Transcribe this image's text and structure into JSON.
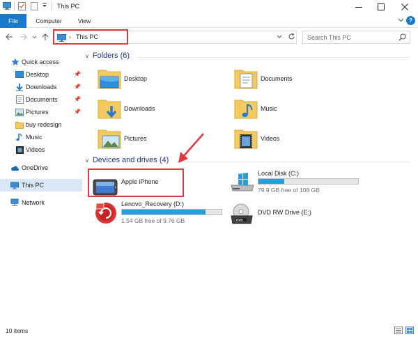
{
  "window": {
    "title": "This PC",
    "controls": {
      "minimize": "minimize",
      "maximize": "maximize",
      "close": "close"
    }
  },
  "ribbon": {
    "tabs": [
      {
        "label": "File",
        "active": true
      },
      {
        "label": "Computer",
        "active": false
      },
      {
        "label": "View",
        "active": false
      }
    ],
    "help": "?"
  },
  "navigation": {
    "address_segment": "This PC",
    "search_placeholder": "Search This PC"
  },
  "sidebar": {
    "quick_access": "Quick access",
    "items": [
      {
        "label": "Desktop",
        "icon": "desktop-folder-icon",
        "pinned": true
      },
      {
        "label": "Downloads",
        "icon": "downloads-icon",
        "pinned": true
      },
      {
        "label": "Documents",
        "icon": "documents-icon",
        "pinned": true
      },
      {
        "label": "Pictures",
        "icon": "pictures-icon",
        "pinned": true
      },
      {
        "label": "buy redesign",
        "icon": "folder-icon",
        "pinned": false
      },
      {
        "label": "Music",
        "icon": "music-icon",
        "pinned": false
      },
      {
        "label": "Videos",
        "icon": "videos-icon",
        "pinned": false
      }
    ],
    "onedrive": "OneDrive",
    "this_pc": "This PC",
    "network": "Network"
  },
  "folders": {
    "heading": "Folders (6)",
    "items": [
      {
        "label": "Desktop",
        "icon": "desktop-folder-icon"
      },
      {
        "label": "Documents",
        "icon": "documents-folder-icon"
      },
      {
        "label": "Downloads",
        "icon": "downloads-folder-icon"
      },
      {
        "label": "Music",
        "icon": "music-folder-icon"
      },
      {
        "label": "Pictures",
        "icon": "pictures-folder-icon"
      },
      {
        "label": "Videos",
        "icon": "videos-folder-icon"
      }
    ]
  },
  "devices": {
    "heading": "Devices and drives (4)",
    "items": [
      {
        "name": "Apple iPhone",
        "icon": "iphone-device-icon"
      },
      {
        "name": "Local Disk (C:)",
        "icon": "local-disk-icon",
        "free": "79.9 GB free of 108 GB",
        "used_fraction": 0.26
      },
      {
        "name": "Lenovo_Recovery (D:)",
        "icon": "recovery-drive-icon",
        "free": "1.54 GB free of 9.76 GB",
        "used_fraction": 0.84
      },
      {
        "name": "DVD RW Drive (E:)",
        "icon": "dvd-drive-icon"
      }
    ]
  },
  "status": {
    "item_count": "10 items"
  },
  "colors": {
    "accent": "#1979ca",
    "group_heading": "#1e3287",
    "highlight_red": "#e03a3f",
    "drive_bar": "#26a0da",
    "selected_bg": "#d9e7f6"
  }
}
